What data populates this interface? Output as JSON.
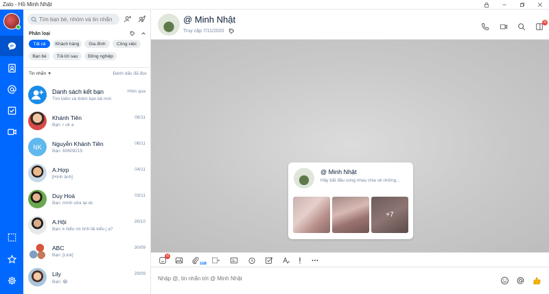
{
  "window": {
    "title": "Zalo - Hồ Minh Nhật"
  },
  "search": {
    "placeholder": "Tìm bạn bè, nhóm và tin nhắn"
  },
  "categories": {
    "label": "Phân loại",
    "chips": [
      "Tất cả",
      "Khách hàng",
      "Gia đình",
      "Công việc",
      "Bạn bè",
      "Trả lời sau",
      "Đồng nghiệp"
    ],
    "active": "Tất cả"
  },
  "messages": {
    "label": "Tin nhắn",
    "mark_read": "Đánh dấu đã đọc"
  },
  "conversations": [
    {
      "name": "Danh sách kết bạn",
      "preview": "Tìm kiếm và thêm bạn bè mới",
      "time": "Hôm qua"
    },
    {
      "name": "Khánh Tiên",
      "preview": "Bạn: r ok a",
      "time": "06/11"
    },
    {
      "name": "Nguyễn Khánh Tiên",
      "preview": "Bạn: 60609215",
      "time": "06/11",
      "initials": "NK"
    },
    {
      "name": "A.Hợp",
      "preview": "[Hình ảnh]",
      "time": "04/11"
    },
    {
      "name": "Duy Hoà",
      "preview": "Bạn: mình sửa lại dc",
      "time": "03/11"
    },
    {
      "name": "A.Hội",
      "preview": "Bạn: k hiểu nó tính lãi kiểu j a?",
      "time": "26/10"
    },
    {
      "name": "ABC",
      "preview": "Bạn: [Link]",
      "time": "30/09"
    },
    {
      "name": "Lily",
      "preview": "Bạn: 😂",
      "time": "29/09"
    }
  ],
  "chat": {
    "name": "@ Minh Nhật",
    "last_seen": "Truy cập 7/11/2020",
    "header_badge": "N",
    "card": {
      "name": "@ Minh Nhật",
      "subtitle": "Hãy bắt đầu cùng nhau chia sẻ những...",
      "more_photos": "+7"
    }
  },
  "toolbar": {
    "sticker_badge": "N",
    "file_size_label": "1GB"
  },
  "composer": {
    "placeholder": "Nhập @, tin nhắn tới @ Minh Nhật"
  },
  "colors": {
    "primary": "#0068ff",
    "badge": "#e3453b",
    "online": "#38c236"
  }
}
